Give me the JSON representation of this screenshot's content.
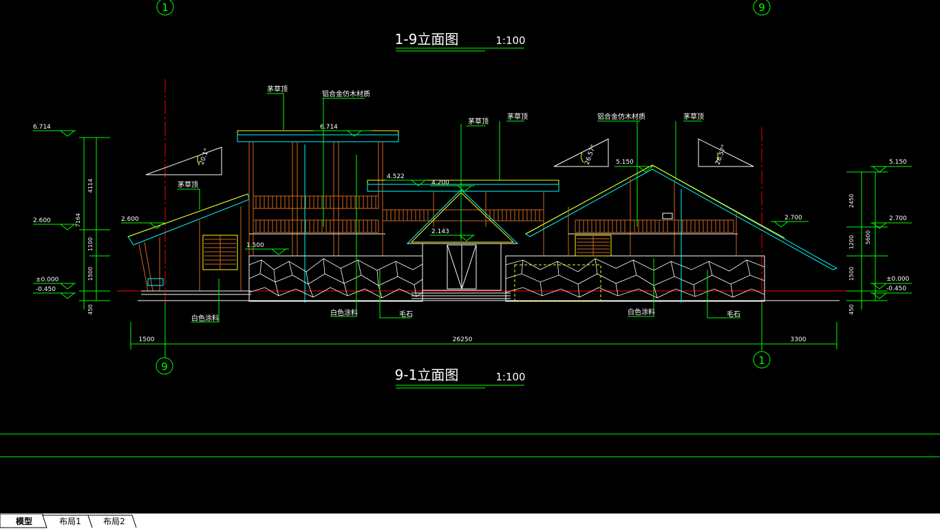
{
  "drawing": {
    "title_top": "1-9立面图",
    "title_top_scale": "1:100",
    "title_bottom": "9-1立面图",
    "title_bottom_scale": "1:100",
    "axis_top_left": "1",
    "axis_top_right": "9",
    "axis_bottom_left": "9",
    "axis_bottom_right": "1",
    "labels": {
      "thatch_1": "茅草顶",
      "thatch_2": "茅草顶",
      "thatch_3": "茅草顶",
      "thatch_4": "茅草顶",
      "thatch_5": "茅草顶",
      "alu_1": "铝合金仿木材质",
      "alu_2": "铝合金仿木材质",
      "white_1": "白色涂料",
      "white_2": "白色涂料",
      "white_3": "白色涂料",
      "stone_1": "毛石",
      "stone_2": "毛石"
    },
    "elevations": {
      "e6714_left": "6.714",
      "e6714_mid": "6.714",
      "e2600_left": "2.600",
      "e2600_mid": "2.600",
      "e0000_left": "±0.000",
      "e0450_left": "-0.450",
      "e4522": "4.522",
      "e4200": "4.200",
      "e2143": "2.143",
      "e1500": "1.500",
      "e5150_mid": "5.150",
      "e5150_right": "5.150",
      "e2700_mid": "2.700",
      "e2700_right": "2.700",
      "e0000_right": "±0.000",
      "e0450_right": "-0.450"
    },
    "angles": {
      "a1": "20.1°",
      "a2": "26.57°",
      "a3": "26.57°"
    },
    "dims": {
      "left_4114": "4114",
      "left_7164": "7164",
      "left_1100": "1100",
      "left_1500": "1500",
      "left_450": "450",
      "right_2450": "2450",
      "right_1200": "1200",
      "right_5600": "5600",
      "right_1500": "1500",
      "right_450": "450",
      "bottom_1500": "1500",
      "bottom_26250": "26250",
      "bottom_3300": "3300"
    }
  },
  "tabs": {
    "model": "模型",
    "layout1": "布局1",
    "layout2": "布局2"
  },
  "colors": {
    "background": "#000000",
    "green": "#00ff00",
    "yellow": "#ffff00",
    "cyan": "#00ffff",
    "red": "#ff0000",
    "orange": "#d2691e",
    "white": "#ffffff"
  }
}
